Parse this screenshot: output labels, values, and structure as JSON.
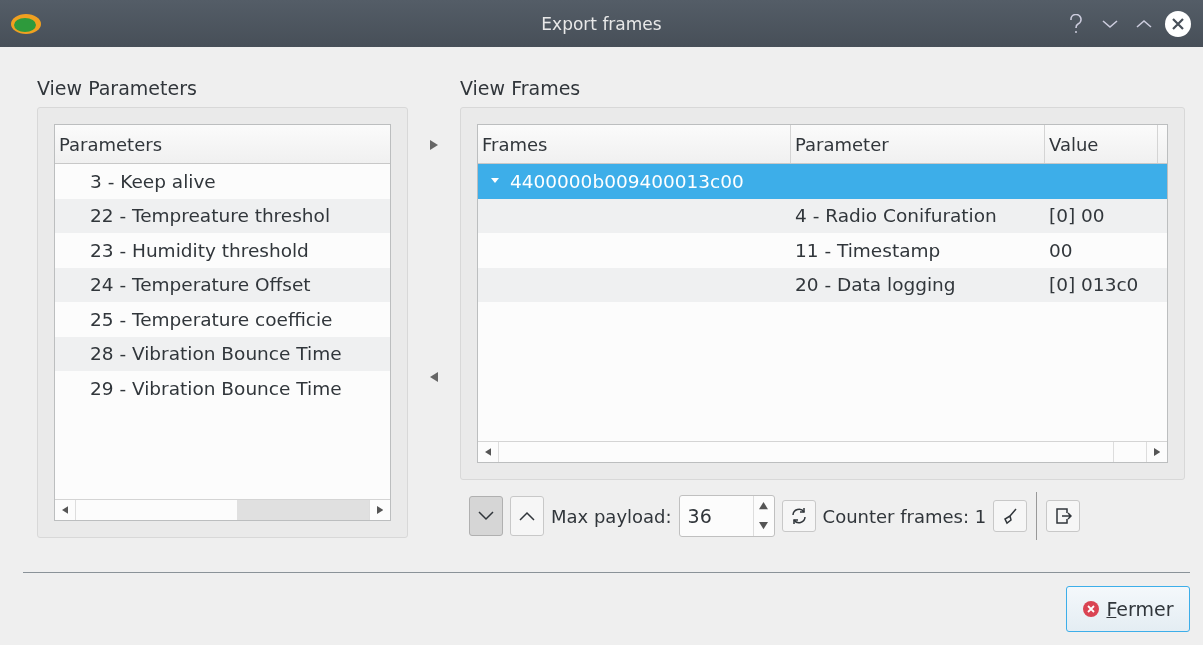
{
  "window": {
    "title": "Export frames"
  },
  "parameters_panel": {
    "title": "View Parameters",
    "header": "Parameters",
    "items": [
      {
        "label": "3 - Keep alive"
      },
      {
        "label": "22 - Tempreature threshol"
      },
      {
        "label": "23 - Humidity threshold"
      },
      {
        "label": "24 - Temperature Offset"
      },
      {
        "label": "25 - Temperature coefficie"
      },
      {
        "label": "28 - Vibration Bounce Time"
      },
      {
        "label": "29 - Vibration Bounce Time"
      }
    ]
  },
  "frames_panel": {
    "title": "View Frames",
    "columns": [
      "Frames",
      "Parameter",
      "Value"
    ],
    "rows": [
      {
        "frame": "4400000b009400013c00",
        "expanded": true,
        "selected": true,
        "children": [
          {
            "parameter": "4 - Radio Conifuration",
            "value": "[0] 00"
          },
          {
            "parameter": "11 - Timestamp",
            "value": "00"
          },
          {
            "parameter": "20 - Data logging",
            "value": "[0] 013c0"
          }
        ]
      }
    ]
  },
  "toolbar": {
    "down_pressed": true,
    "max_payload_label": "Max payload:",
    "max_payload": "36",
    "counter_label": "Counter frames: 1"
  },
  "buttons": [
    {
      "label": "Fermer"
    }
  ]
}
